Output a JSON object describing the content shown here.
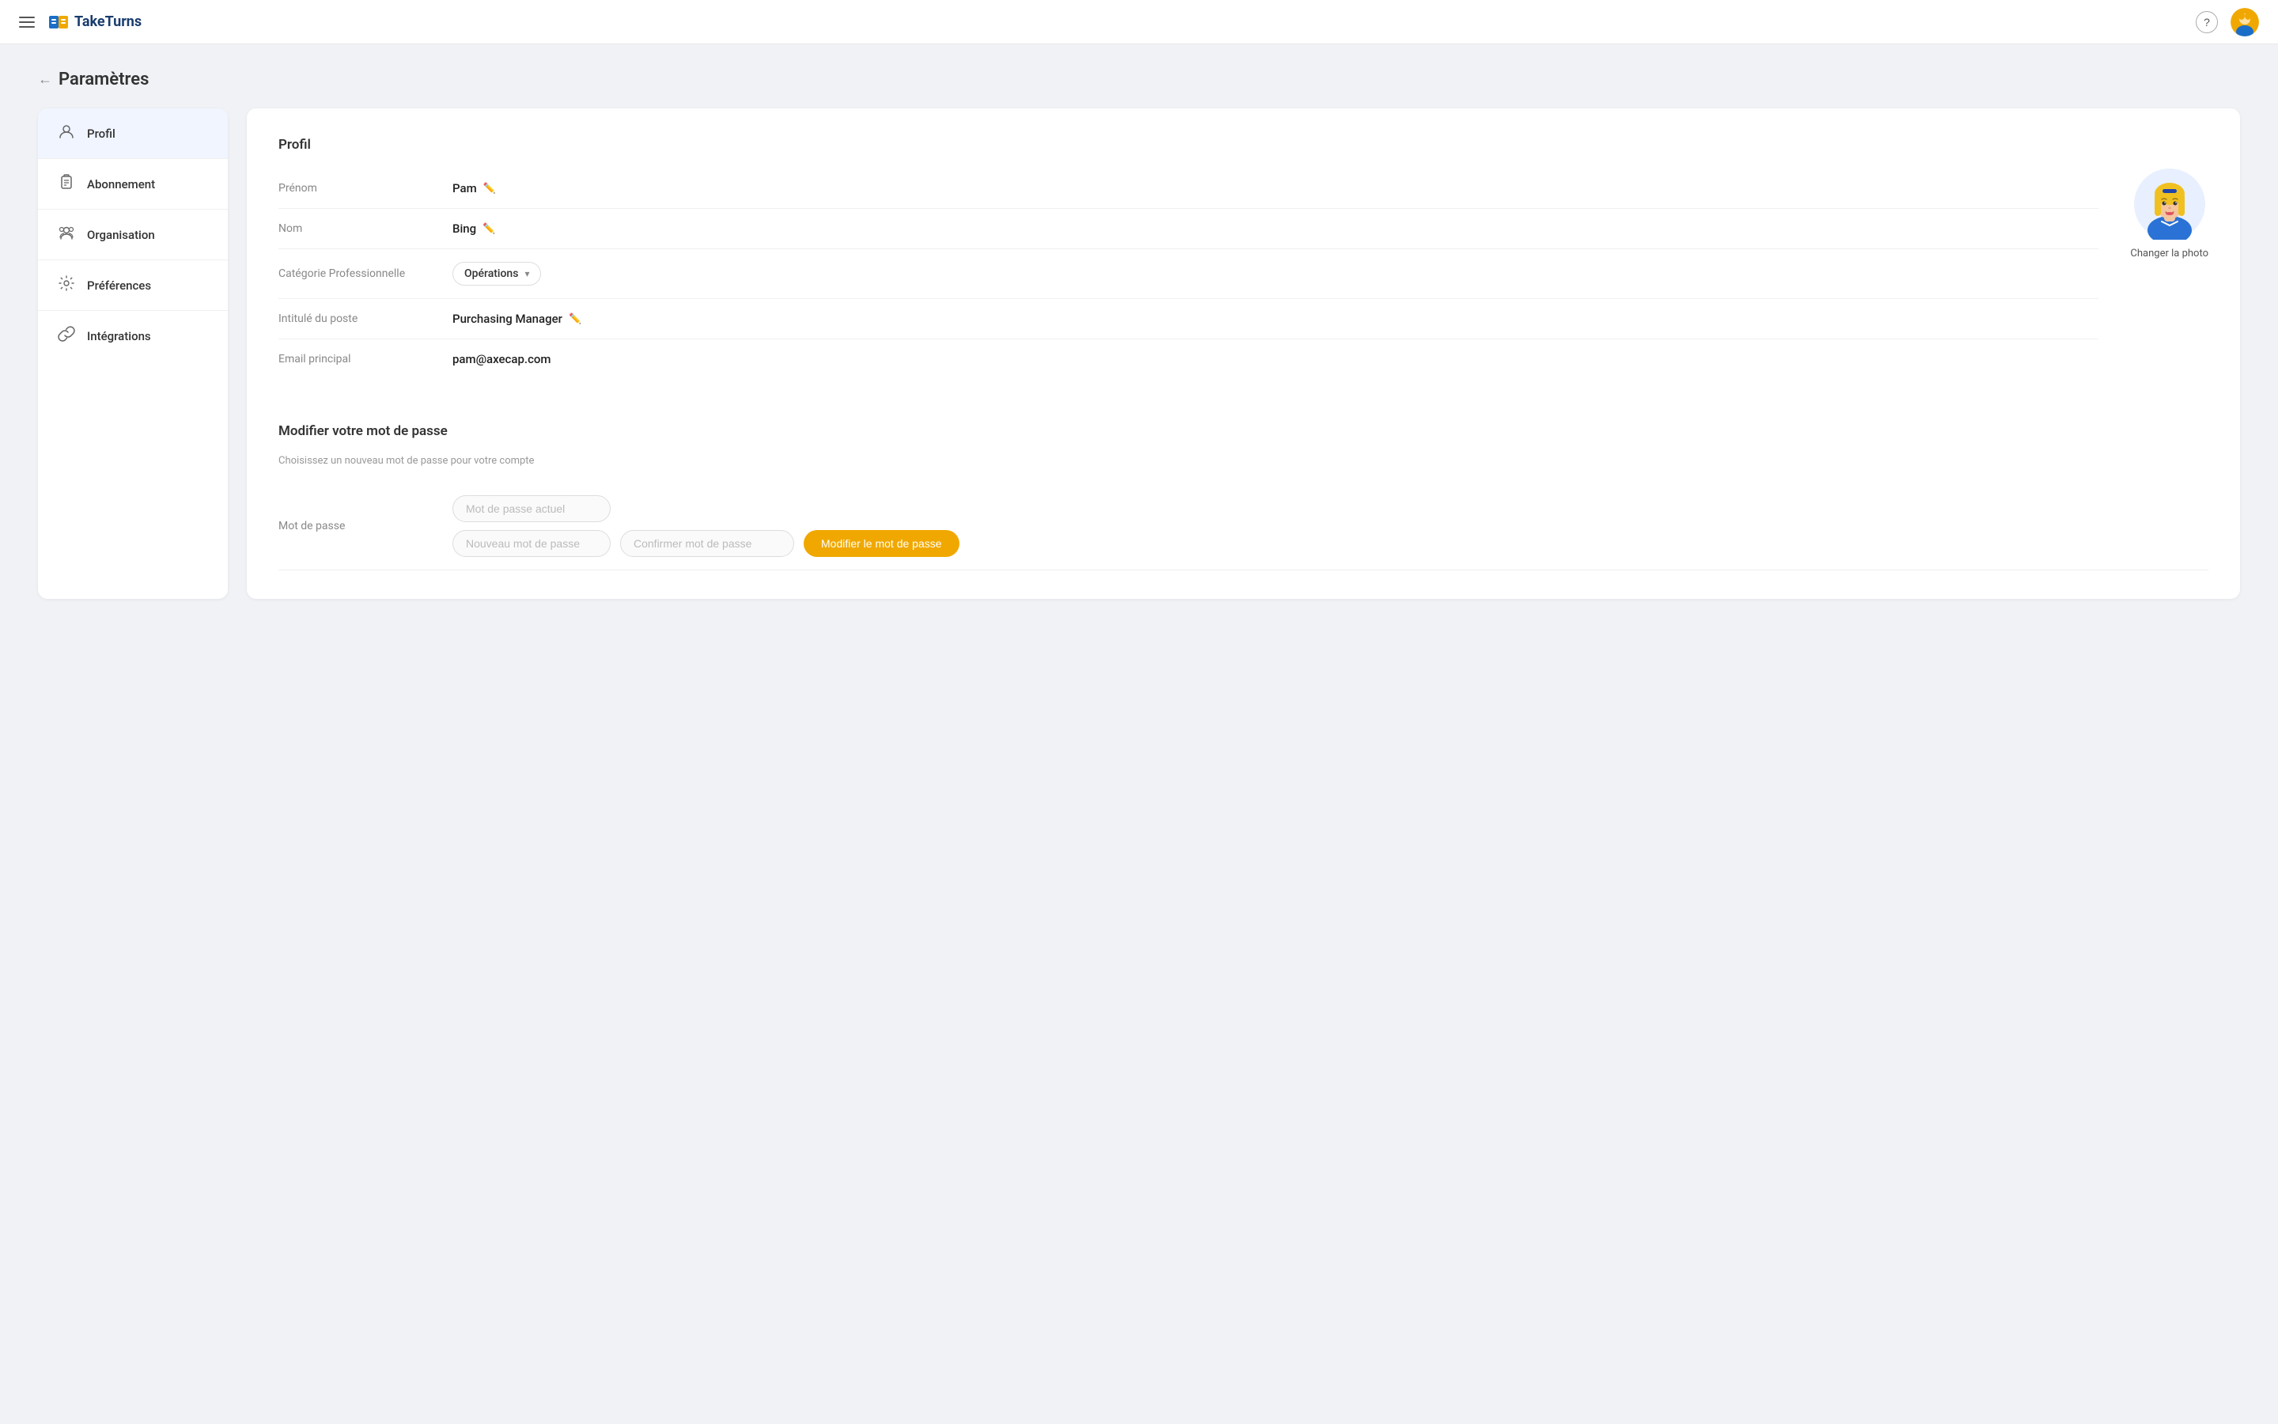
{
  "header": {
    "logo_text": "TakeTurns",
    "help_icon": "?",
    "hamburger_icon": "menu-icon"
  },
  "breadcrumb": {
    "back_arrow": "←",
    "title": "Paramètres"
  },
  "sidebar": {
    "items": [
      {
        "id": "profil",
        "label": "Profil",
        "icon": "user-icon",
        "active": true
      },
      {
        "id": "abonnement",
        "label": "Abonnement",
        "icon": "clipboard-icon",
        "active": false
      },
      {
        "id": "organisation",
        "label": "Organisation",
        "icon": "group-icon",
        "active": false
      },
      {
        "id": "preferences",
        "label": "Préférences",
        "icon": "gear-icon",
        "active": false
      },
      {
        "id": "integrations",
        "label": "Intégrations",
        "icon": "link-icon",
        "active": false
      }
    ]
  },
  "profile": {
    "section_title": "Profil",
    "fields": [
      {
        "label": "Prénom",
        "value": "Pam",
        "editable": true
      },
      {
        "label": "Nom",
        "value": "Bing",
        "editable": true
      },
      {
        "label": "Catégorie Professionnelle",
        "value": "Opérations",
        "type": "dropdown"
      },
      {
        "label": "Intitulé du poste",
        "value": "Purchasing Manager",
        "editable": true
      },
      {
        "label": "Email principal",
        "value": "pam@axecap.com",
        "editable": false
      }
    ],
    "avatar_alt": "User avatar - woman with blonde hair",
    "change_photo_label": "Changer la photo"
  },
  "password": {
    "section_title": "Modifier votre mot de passe",
    "description": "Choisissez un nouveau mot de passe pour votre compte",
    "field_label": "Mot de passe",
    "current_placeholder": "Mot de passe actuel",
    "new_placeholder": "Nouveau mot de passe",
    "confirm_placeholder": "Confirmer mot de passe",
    "save_button": "Modifier le mot de passe"
  }
}
